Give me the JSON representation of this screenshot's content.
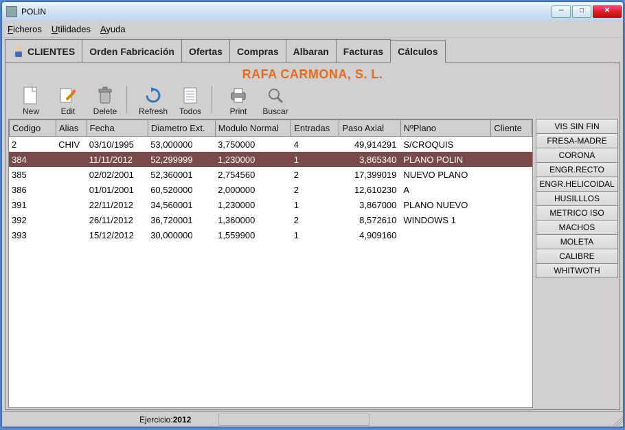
{
  "window": {
    "title": "POLIN"
  },
  "menu": {
    "items": [
      "Ficheros",
      "Utilidades",
      "Ayuda"
    ]
  },
  "tabs": [
    "CLIENTES",
    "Orden Fabricación",
    "Ofertas",
    "Compras",
    "Albaran",
    "Facturas",
    "Cálculos"
  ],
  "active_tab": 6,
  "company": "RAFA CARMONA, S. L.",
  "toolbar": {
    "new": "New",
    "edit": "Edit",
    "delete": "Delete",
    "refresh": "Refresh",
    "todos": "Todos",
    "print": "Print",
    "buscar": "Buscar"
  },
  "columns": [
    "Codigo",
    "Alias",
    "Fecha",
    "Diametro Ext.",
    "Modulo Normal",
    "Entradas",
    "Paso Axial",
    "NºPlano",
    "Cliente"
  ],
  "rows": [
    {
      "codigo": "2",
      "alias": "CHIV",
      "fecha": "03/10/1995",
      "diam": "53,000000",
      "mod": "3,750000",
      "ent": "4",
      "paso": "49,914291",
      "plano": "S/CROQUIS",
      "cli": ""
    },
    {
      "codigo": "384",
      "alias": "",
      "fecha": "11/11/2012",
      "diam": "52,299999",
      "mod": "1,230000",
      "ent": "1",
      "paso": "3,865340",
      "plano": "PLANO POLIN",
      "cli": "",
      "selected": true
    },
    {
      "codigo": "385",
      "alias": "",
      "fecha": "02/02/2001",
      "diam": "52,360001",
      "mod": "2,754560",
      "ent": "2",
      "paso": "17,399019",
      "plano": "NUEVO PLANO",
      "cli": ""
    },
    {
      "codigo": "386",
      "alias": "",
      "fecha": "01/01/2001",
      "diam": "60,520000",
      "mod": "2,000000",
      "ent": "2",
      "paso": "12,610230",
      "plano": "A",
      "cli": ""
    },
    {
      "codigo": "391",
      "alias": "",
      "fecha": "22/11/2012",
      "diam": "34,560001",
      "mod": "1,230000",
      "ent": "1",
      "paso": "3,867000",
      "plano": "PLANO NUEVO",
      "cli": ""
    },
    {
      "codigo": "392",
      "alias": "",
      "fecha": "26/11/2012",
      "diam": "36,720001",
      "mod": "1,360000",
      "ent": "2",
      "paso": "8,572610",
      "plano": "WINDOWS 1",
      "cli": ""
    },
    {
      "codigo": "393",
      "alias": "",
      "fecha": "15/12/2012",
      "diam": "30,000000",
      "mod": "1,559900",
      "ent": "1",
      "paso": "4,909160",
      "plano": "",
      "cli": ""
    }
  ],
  "sidebuttons": [
    "VIS SIN FIN",
    "FRESA-MADRE",
    "CORONA",
    "ENGR.RECTO",
    "ENGR.HELICOIDAL",
    "HUSILLLOS",
    "METRICO ISO",
    "MACHOS",
    "MOLETA",
    "CALIBRE",
    "WHITWOTH"
  ],
  "status": {
    "ejercicio_label": "Ejercicio:",
    "ejercicio_value": "2012"
  }
}
